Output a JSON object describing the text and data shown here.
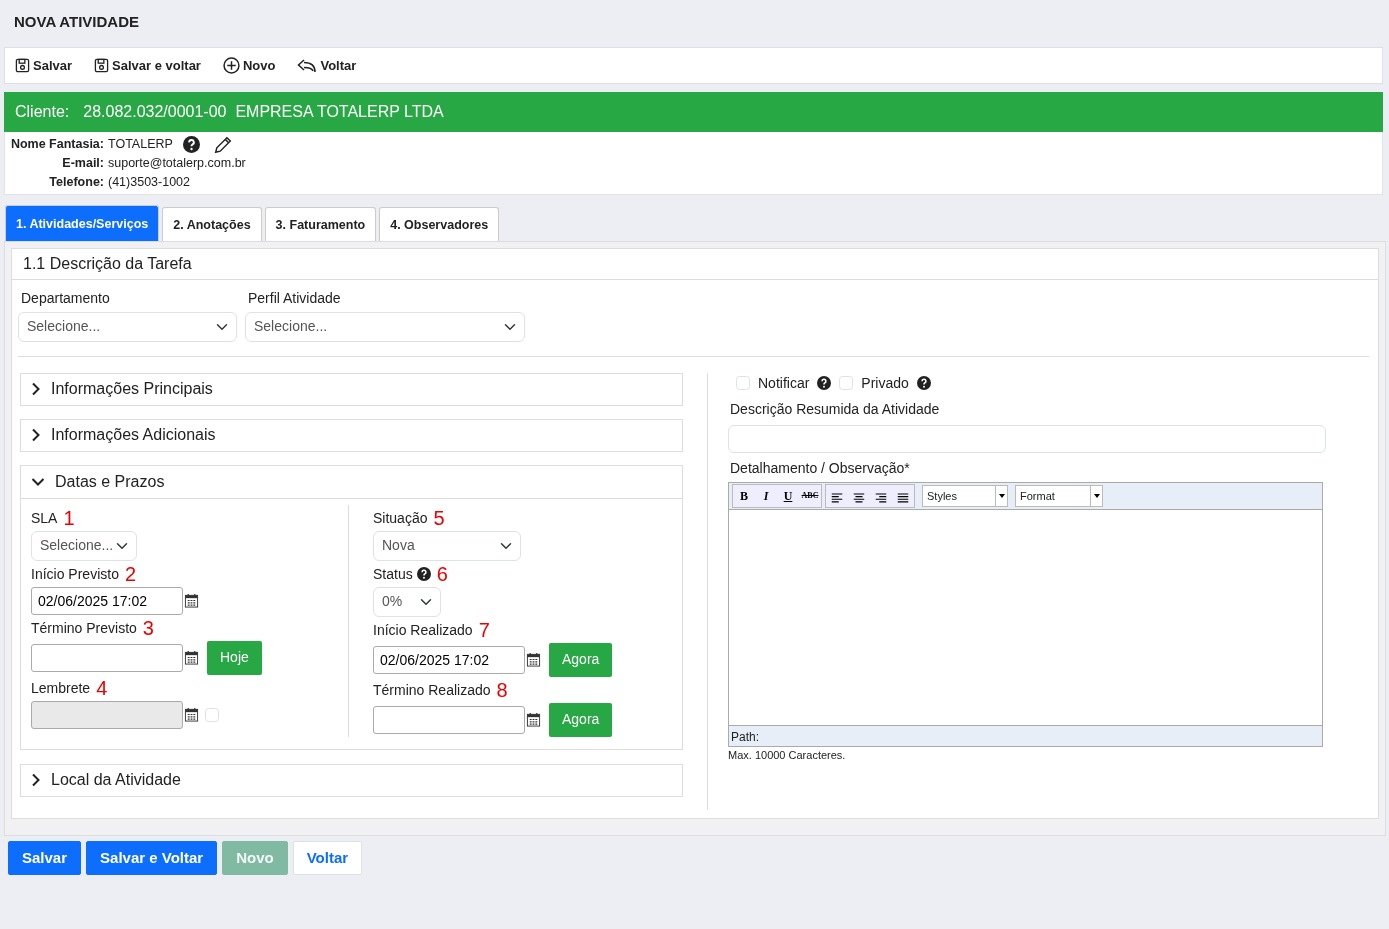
{
  "page_title": "NOVA ATIVIDADE",
  "toolbar": [
    {
      "label": "Salvar"
    },
    {
      "label": "Salvar e voltar"
    },
    {
      "label": "Novo"
    },
    {
      "label": "Voltar"
    }
  ],
  "client": {
    "label": "Cliente:",
    "document": "28.082.032/0001-00",
    "name": "EMPRESA TOTALERP LTDA"
  },
  "client_details": [
    {
      "label": "Nome Fantasia:",
      "value": "TOTALERP",
      "actions": true
    },
    {
      "label": "E-mail:",
      "value": "suporte@totalerp.com.br",
      "actions": false
    },
    {
      "label": "Telefone:",
      "value": "(41)3503-1002",
      "actions": false
    }
  ],
  "tabs": [
    {
      "label": "1. Atividades/Serviços",
      "selected": true
    },
    {
      "label": "2. Anotações",
      "selected": false
    },
    {
      "label": "3. Faturamento",
      "selected": false
    },
    {
      "label": "4. Observadores",
      "selected": false
    }
  ],
  "section_title": "1.1 Descrição da Tarefa",
  "top_fields": [
    {
      "label": "Departamento",
      "value": "Selecione..."
    },
    {
      "label": "Perfil Atividade",
      "value": "Selecione..."
    }
  ],
  "accordion": [
    {
      "title": "Informações Principais",
      "expanded": false
    },
    {
      "title": "Informações Adicionais",
      "expanded": false
    },
    {
      "title": "Datas e Prazos",
      "expanded": true
    },
    {
      "title": "Local da Atividade",
      "expanded": false
    }
  ],
  "dates_left": [
    {
      "kind": "select",
      "label": "SLA",
      "marker": "1",
      "value": "Selecione..."
    },
    {
      "kind": "date",
      "label": "Início Previsto",
      "marker": "2",
      "value": "02/06/2025 17:02"
    },
    {
      "kind": "date-button",
      "label": "Término Previsto",
      "marker": "3",
      "button": "Hoje"
    },
    {
      "kind": "date-check",
      "label": "Lembrete",
      "marker": "4",
      "disabled": true,
      "checked": false
    }
  ],
  "dates_right": [
    {
      "kind": "select",
      "label": "Situação",
      "marker": "5",
      "value": "Nova",
      "help": false
    },
    {
      "kind": "select-small",
      "label": "Status",
      "marker": "6",
      "value": "0%",
      "help": true
    },
    {
      "kind": "date-button",
      "label": "Início Realizado",
      "marker": "7",
      "value": "02/06/2025 17:02",
      "button": "Agora"
    },
    {
      "kind": "date-button",
      "label": "Término Realizado",
      "marker": "8",
      "button": "Agora"
    }
  ],
  "options": [
    {
      "label": "Notificar",
      "checked": false
    },
    {
      "label": "Privado",
      "checked": false
    }
  ],
  "summary_label": "Descrição Resumida da Atividade",
  "editor": {
    "label": "Detalhamento / Observação*",
    "format_buttons": [
      "B",
      "I",
      "U",
      "ABC"
    ],
    "styles": "Styles",
    "format": "Format",
    "path_label": "Path:",
    "note": "Max. 10000 Caracteres."
  },
  "buttons": [
    {
      "label": "Salvar",
      "kind": "primary",
      "disabled": false
    },
    {
      "label": "Salvar e Voltar",
      "kind": "primary",
      "disabled": false
    },
    {
      "label": "Novo",
      "kind": "success",
      "disabled": true
    },
    {
      "label": "Voltar",
      "kind": "light",
      "disabled": false
    }
  ]
}
